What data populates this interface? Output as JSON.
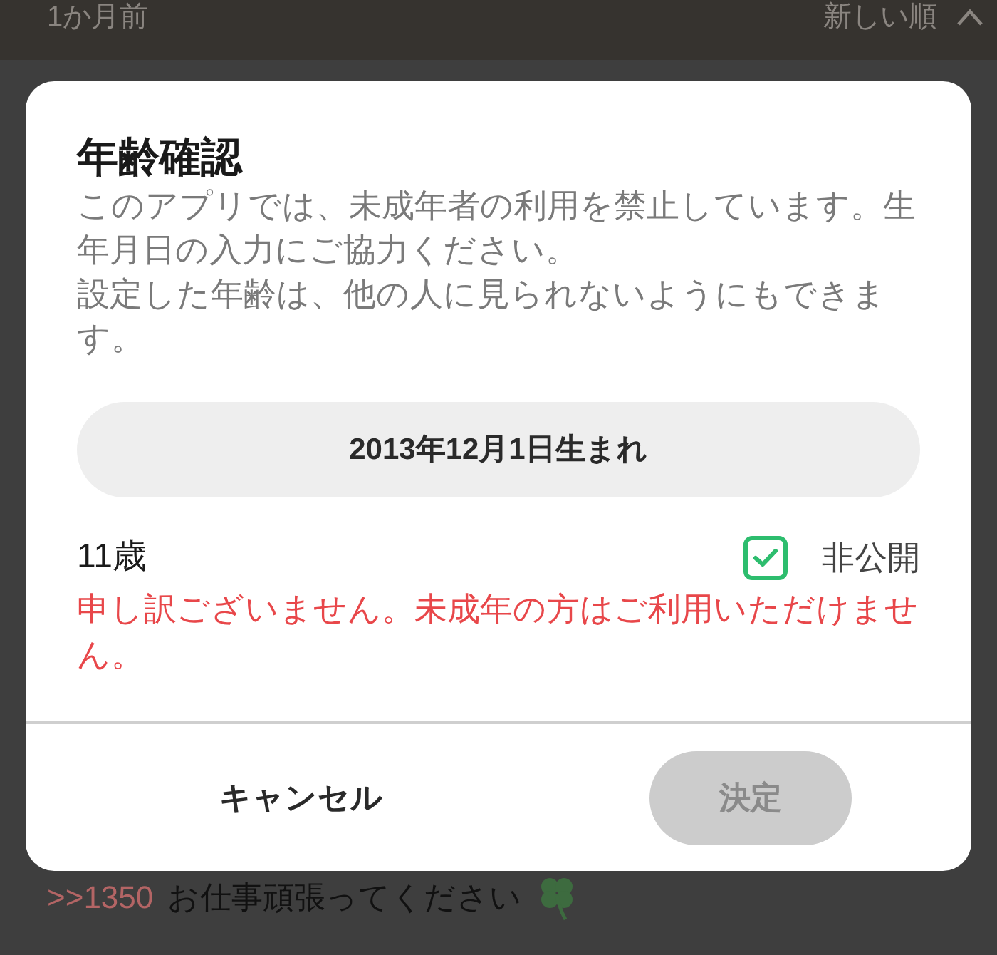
{
  "background": {
    "header": {
      "time": "1か月前",
      "sort": "新しい順"
    },
    "comment": {
      "reply_to": ">>1350",
      "text": "お仕事頑張ってください"
    }
  },
  "dialog": {
    "title": "年齢確認",
    "message": [
      "このアプリでは、未成年者の利用を禁止しています。生年月日の入力にご協力ください。",
      "設定した年齢は、他の人に見られないようにもできます。"
    ],
    "birthdate_button": "2013年12月1日生まれ",
    "age": "11歳",
    "private_checkbox": {
      "label": "非公開",
      "checked": true
    },
    "error": "申し訳ございません。未成年の方はご利用いただけません。",
    "buttons": [
      {
        "label": "キャンセル",
        "kind": "text",
        "disabled": false
      },
      {
        "label": "決定",
        "kind": "filled",
        "disabled": true
      }
    ]
  }
}
